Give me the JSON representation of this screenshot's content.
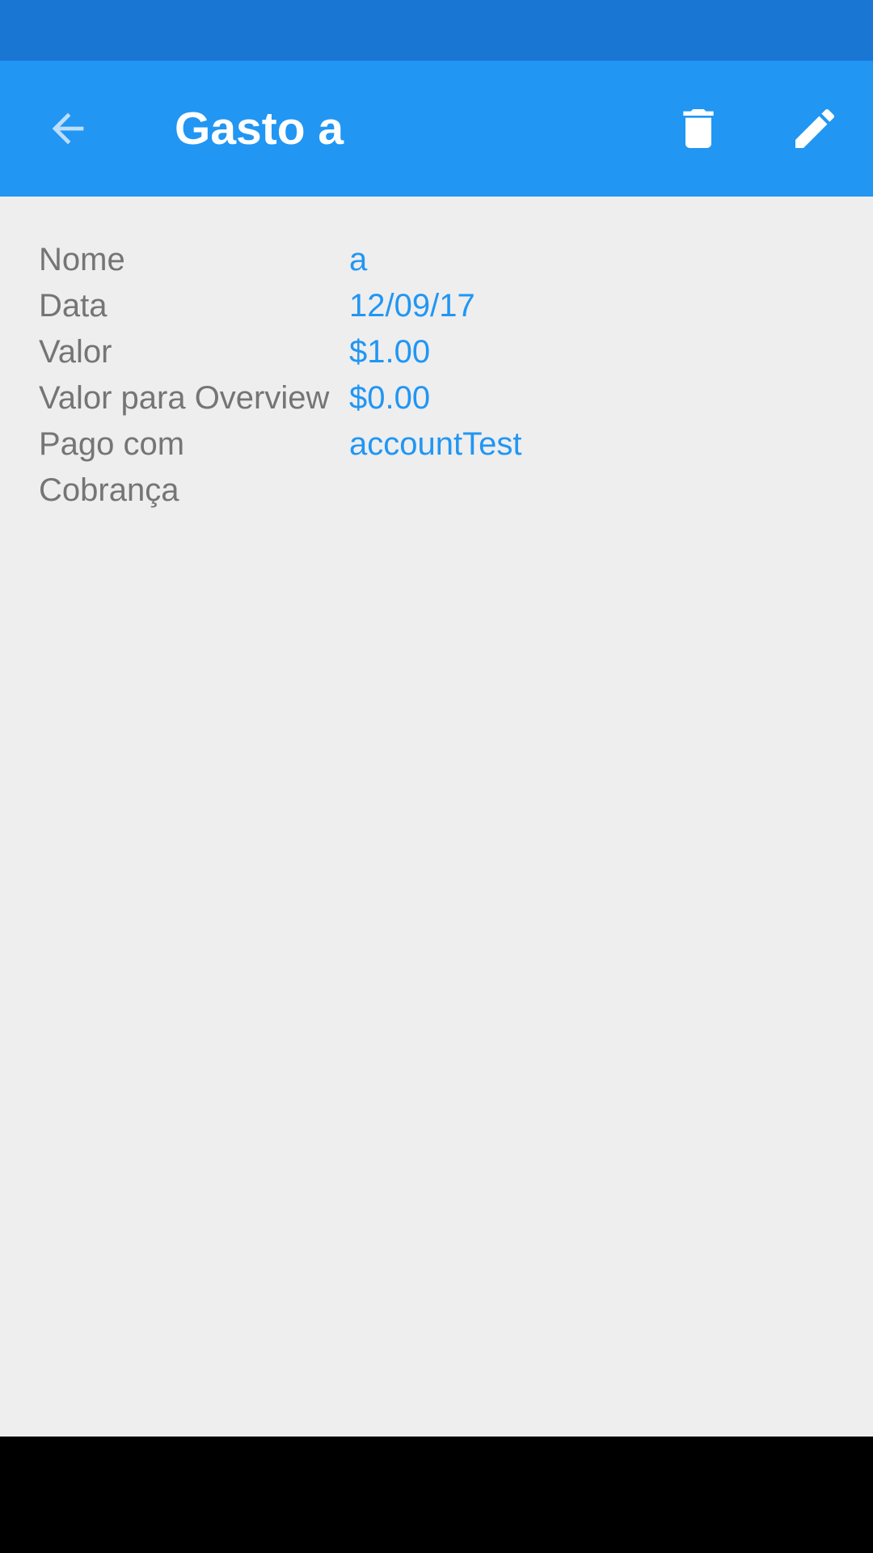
{
  "app_bar": {
    "title": "Gasto a",
    "back_icon": "arrow-back-icon",
    "delete_icon": "trash-icon",
    "edit_icon": "pencil-icon",
    "background": "#2196f3",
    "status_bar_color": "#1976d2"
  },
  "details": {
    "label_color": "#757575",
    "value_color": "#2196f3",
    "rows": [
      {
        "label": "Nome",
        "value": "a"
      },
      {
        "label": "Data",
        "value": "12/09/17"
      },
      {
        "label": "Valor",
        "value": "$1.00"
      },
      {
        "label": "Valor para Overview",
        "value": "$0.00"
      },
      {
        "label": "Pago com",
        "value": "accountTest"
      },
      {
        "label": "Cobrança",
        "value": ""
      }
    ]
  }
}
